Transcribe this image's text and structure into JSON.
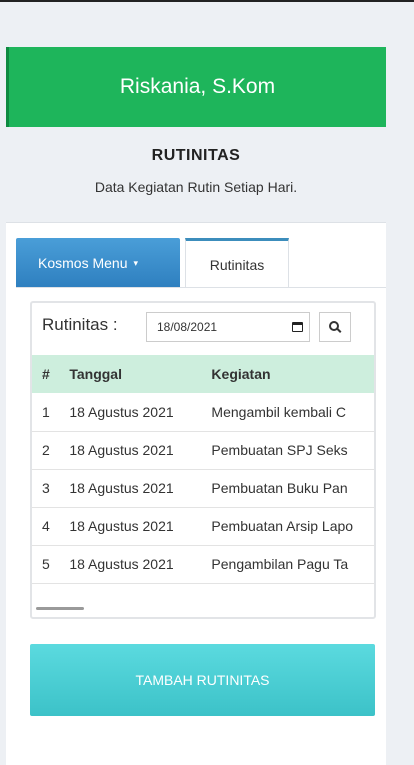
{
  "header": {
    "user_name": "Riskania, S.Kom"
  },
  "subheader": {
    "title": "RUTINITAS",
    "description": "Data Kegiatan Rutin Setiap Hari."
  },
  "tabs": {
    "menu_label": "Kosmos Menu",
    "caret": "▾",
    "active_label": "Rutinitas"
  },
  "filter": {
    "label": "Rutinitas :",
    "date_value": "18/08/2021"
  },
  "table": {
    "columns": [
      "#",
      "Tanggal",
      "Kegiatan"
    ],
    "rows": [
      {
        "no": "1",
        "tanggal": "18 Agustus 2021",
        "kegiatan": "Mengambil kembali C"
      },
      {
        "no": "2",
        "tanggal": "18 Agustus 2021",
        "kegiatan": "Pembuatan SPJ Seks"
      },
      {
        "no": "3",
        "tanggal": "18 Agustus 2021",
        "kegiatan": "Pembuatan Buku Pan"
      },
      {
        "no": "4",
        "tanggal": "18 Agustus 2021",
        "kegiatan": "Pembuatan Arsip Lapo"
      },
      {
        "no": "5",
        "tanggal": "18 Agustus 2021",
        "kegiatan": "Pengambilan Pagu Ta"
      }
    ]
  },
  "actions": {
    "add_label": "TAMBAH RUTINITAS"
  },
  "icons": {
    "calendar": "calendar-icon",
    "search": "search-icon"
  },
  "colors": {
    "header_green": "#1eb55b",
    "tab_blue": "#3c8dbc",
    "table_head": "#cdeedd",
    "add_button": "#45c9cf"
  }
}
